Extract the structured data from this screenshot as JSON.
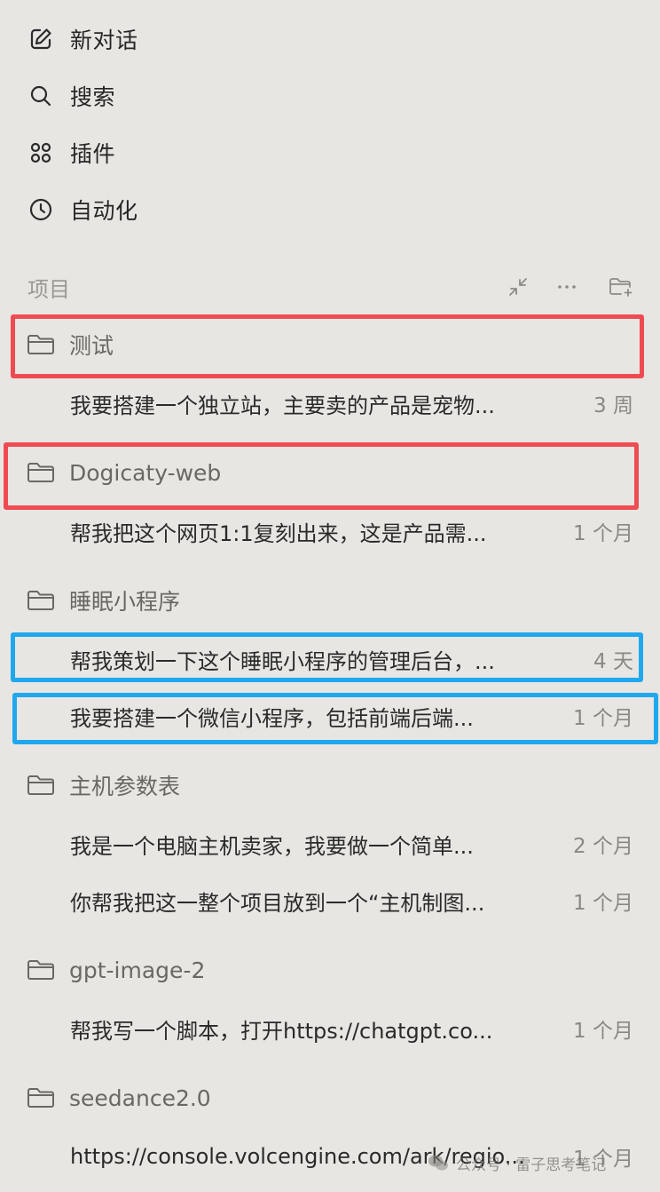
{
  "nav": {
    "new_chat": "新对话",
    "search": "搜索",
    "plugins": "插件",
    "automation": "自动化"
  },
  "section": {
    "title": "项目"
  },
  "projects": [
    {
      "name": "测试",
      "chats": [
        {
          "title": "我要搭建一个独立站，主要卖的产品是宠物...",
          "time": "3 周"
        }
      ]
    },
    {
      "name": "Dogicaty-web",
      "chats": [
        {
          "title": "帮我把这个网页1:1复刻出来，这是产品需...",
          "time": "1 个月"
        }
      ]
    },
    {
      "name": "睡眠小程序",
      "chats": [
        {
          "title": "帮我策划一下这个睡眠小程序的管理后台，...",
          "time": "4 天"
        },
        {
          "title": "我要搭建一个微信小程序，包括前端后端...",
          "time": "1 个月"
        }
      ]
    },
    {
      "name": "主机参数表",
      "chats": [
        {
          "title": "我是一个电脑主机卖家，我要做一个简单...",
          "time": "2 个月"
        },
        {
          "title": "你帮我把这一整个项目放到一个“主机制图...",
          "time": "1 个月"
        }
      ]
    },
    {
      "name": "gpt-image-2",
      "chats": [
        {
          "title": "帮我写一个脚本，打开https://chatgpt.co...",
          "time": "1 个月"
        }
      ]
    },
    {
      "name": "seedance2.0",
      "chats": [
        {
          "title": "https://console.volcengine.com/ark/regio...",
          "time": "1 个月"
        }
      ]
    }
  ],
  "watermark": {
    "text": "公众号 · 雷子思考笔记"
  },
  "colors": {
    "background": "#e8e6e3",
    "highlight_red": "#ef4c52",
    "highlight_blue": "#20a8ee"
  }
}
